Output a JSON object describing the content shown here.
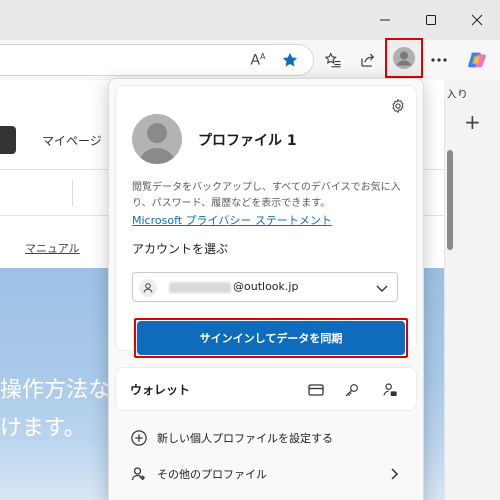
{
  "window": {
    "minimize_icon": "minimize-icon",
    "maximize_icon": "maximize-icon",
    "close_icon": "close-icon"
  },
  "toolbar": {
    "read_aloud_label": "A",
    "read_aloud_superscript": "A",
    "favorites_label": "入り"
  },
  "page": {
    "my_page": "マイページ",
    "manual": "マニュアル",
    "hero_line1": "操作方法な",
    "hero_line2": "けます。"
  },
  "profile_flyout": {
    "profile_name": "プロファイル 1",
    "description": "閲覧データをバックアップし、すべてのデバイスでお気に入り、パスワード、履歴などを表示できます。",
    "privacy_link": "Microsoft プライバシー ステートメント",
    "choose_account_label": "アカウントを選ぶ",
    "account_domain": "@outlook.jp",
    "signin_button": "サインインしてデータを同期",
    "wallet_label": "ウォレット",
    "menu": [
      {
        "label": "新しい個人プロファイルを設定する",
        "icon": "add-circle-icon"
      },
      {
        "label": "その他のプロファイル",
        "icon": "switch-profile-icon"
      }
    ]
  },
  "colors": {
    "accent": "#0f6cbd",
    "highlight": "#e00000",
    "favorite_star": "#0f6cbd"
  }
}
